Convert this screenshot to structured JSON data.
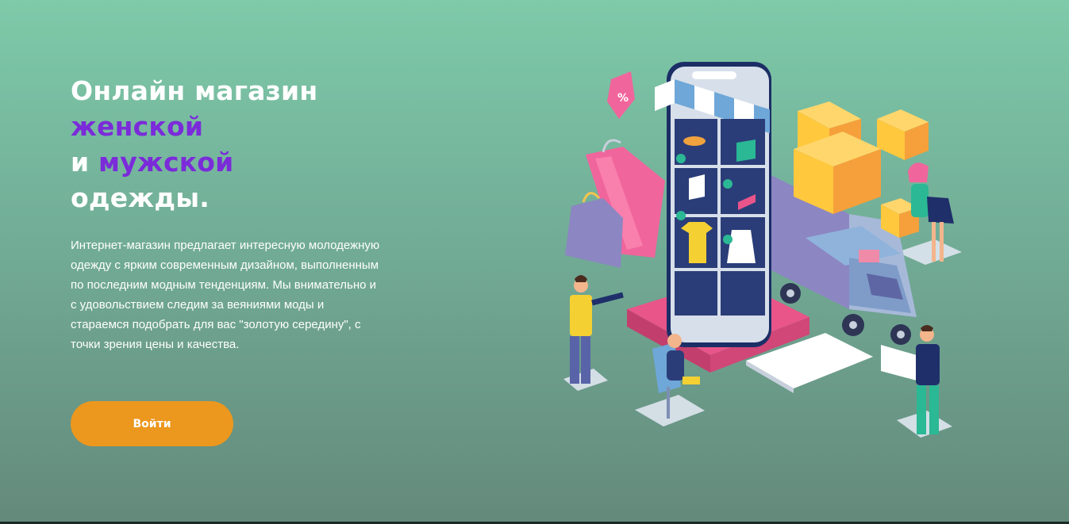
{
  "hero": {
    "headline": {
      "line1": "Онлайн магазин",
      "line2_accent": "женской",
      "line3_prefix": "и ",
      "line3_accent": "мужской",
      "line4": "одежды."
    },
    "description": "Интернет-магазин предлагает интересную молодежную одежду с ярким современным дизайном, выполненным по последним модным тенденциям. Мы внимательно и с удовольствием следим за веяниями моды и стараемся подобрать для вас \"золотую середину\", с точки зрения цены и качества.",
    "login_label": "Войти"
  },
  "illustration": {
    "discount_tag_text": "%"
  },
  "colors": {
    "accent_purple": "#7b2bd9",
    "button_orange": "#ec971d",
    "bg_top": "#7ecaa9",
    "bg_bottom": "#64897b"
  }
}
